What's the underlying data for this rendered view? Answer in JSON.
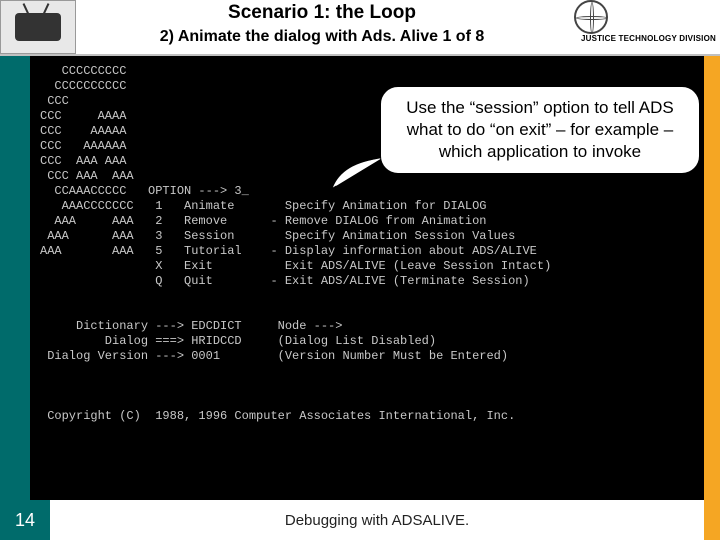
{
  "header": {
    "title": "Scenario 1: the Loop",
    "subtitle": "2) Animate the dialog with Ads. Alive 1 of  8",
    "division": "JUSTICE TECHNOLOGY DIVISION"
  },
  "callout": {
    "text": "Use the “session” option to tell ADS what to do “on exit” – for example – which application to invoke"
  },
  "terminal": {
    "ascii": "   CCCCCCCCC\n  CCCCCCCCCC\n CCC\nCCC     AAAA\nCCC    AAAAA\nCCC   AAAAAA\nCCC  AAA AAA\n CCC AAA  AAA\n  CCAAACCCCC   OPTION ---> 3_\n   AAACCCCCCC   1   Animate       Specify Animation for DIALOG\n  AAA     AAA   2   Remove      - Remove DIALOG from Animation\n AAA      AAA   3   Session       Specify Animation Session Values\nAAA       AAA   5   Tutorial    - Display information about ADS/ALIVE\n                X   Exit          Exit ADS/ALIVE (Leave Session Intact)\n                Q   Quit        - Exit ADS/ALIVE (Terminate Session)\n\n\n     Dictionary ---> EDCDICT     Node --->\n         Dialog ===> HRIDCCD     (Dialog List Disabled)\n Dialog Version ---> 0001        (Version Number Must be Entered)\n\n\n\n Copyright (C)  1988, 1996 Computer Associates International, Inc."
  },
  "footer": {
    "page": "14",
    "text": "Debugging with ADSALIVE."
  }
}
